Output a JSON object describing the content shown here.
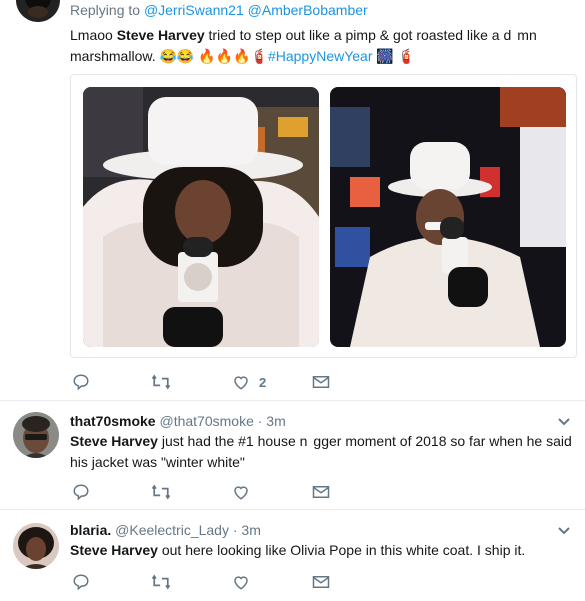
{
  "tweet1": {
    "replying_prefix": "Replying to",
    "mentions": "@JerriSwann21 @AmberBobamber",
    "bold_name": "Steve Harvey",
    "text_before": "Lmaoo ",
    "text_after": " tried to step out like a pimp & got roasted like a d",
    "text_after2": "mn",
    "text_line2": "marshmallow. 😂😂  🔥🔥🔥🧯",
    "hashtag": "#HappyNewYear",
    "emoji_tail": "🎆 🧯",
    "like_count": "2"
  },
  "tweet2": {
    "display_name": "that70smoke",
    "handle": "@that70smoke",
    "time": "· 3m",
    "bold_name": "Steve Harvey",
    "text1": " just had the #1 house n",
    "text1b": "gger moment of 2018 so far when he said",
    "text2": "his jacket was \"winter white\""
  },
  "tweet3": {
    "display_name": "blaria.",
    "handle": "@Keelectric_Lady",
    "time": "· 3m",
    "bold_name": "Steve Harvey",
    "text1": " out here looking like Olivia Pope in this white coat. I ship it."
  },
  "icons": {
    "reply": "reply-icon",
    "retweet": "retweet-icon",
    "like": "heart-icon",
    "message": "envelope-icon",
    "caret": "chevron-down-icon"
  },
  "colors": {
    "link": "#1b95e0",
    "muted": "#657786",
    "text": "#14171a",
    "divider": "#e6ecf0"
  }
}
